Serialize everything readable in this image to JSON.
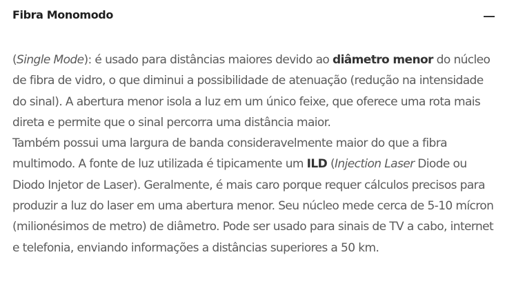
{
  "accordion": {
    "title": "Fibra Monomodo",
    "collapse_icon": "minus-icon",
    "paragraph1": {
      "open_paren": "(",
      "single_mode": "Single Mode",
      "p1_text1": "): é usado para distâncias maiores devido ao ",
      "diametro_menor": "diâmetro menor",
      "p1_text2": " do núcleo de fibra de vidro, o que diminui a possibilidade de atenuação (redução na intensidade do sinal). A abertura menor isola a luz em um único feixe, que oferece uma rota mais direta e permite que o sinal percorra uma distância maior."
    },
    "paragraph2": {
      "p2_text1": "Também possui uma largura de banda consideravelmente maior do que a fibra multimodo. A fonte de luz utilizada é tipicamente um ",
      "ild": "ILD",
      "p2_text2": " (",
      "injection_laser": "Injection Laser",
      "p2_text3": " Diode ou Diodo Injetor de Laser). Geralmente, é mais caro porque requer cálculos precisos para produzir a luz do laser em uma abertura menor. Seu núcleo mede cerca de 5-10 mícron (milionésimos de metro) de diâmetro. Pode ser usado para sinais de TV a cabo, internet e telefonia, enviando informações a distâncias superiores a 50 km."
    }
  }
}
